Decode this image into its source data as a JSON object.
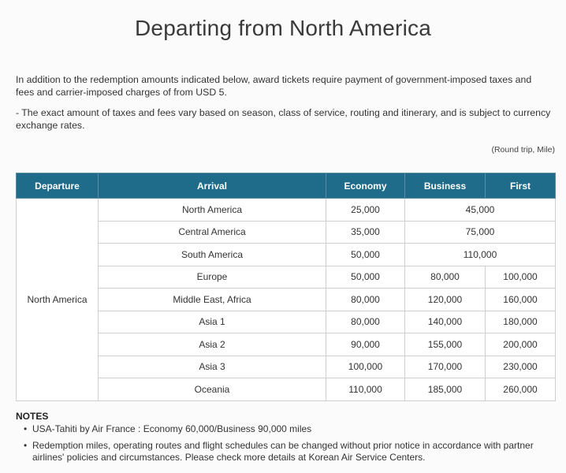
{
  "page": {
    "title": "Departing from North America",
    "intro": [
      "In addition to the redemption amounts indicated below, award tickets require payment of government-imposed taxes and fees and carrier-imposed charges of from USD 5.",
      "- The exact amount of taxes and fees vary based on season, class of service, routing and itinerary, and is subject to currency exchange rates."
    ],
    "unit_note": "(Round trip, Mile)"
  },
  "table": {
    "headers": {
      "departure": "Departure",
      "arrival": "Arrival",
      "economy": "Economy",
      "business": "Business",
      "first": "First"
    },
    "departure": "North America",
    "rows": [
      {
        "arrival": "North America",
        "economy": "25,000",
        "business_first": "45,000"
      },
      {
        "arrival": "Central America",
        "economy": "35,000",
        "business_first": "75,000"
      },
      {
        "arrival": "South America",
        "economy": "50,000",
        "business_first": "110,000"
      },
      {
        "arrival": "Europe",
        "economy": "50,000",
        "business": "80,000",
        "first": "100,000"
      },
      {
        "arrival": "Middle East, Africa",
        "economy": "80,000",
        "business": "120,000",
        "first": "160,000"
      },
      {
        "arrival": "Asia 1",
        "economy": "80,000",
        "business": "140,000",
        "first": "180,000"
      },
      {
        "arrival": "Asia 2",
        "economy": "90,000",
        "business": "155,000",
        "first": "200,000"
      },
      {
        "arrival": "Asia 3",
        "economy": "100,000",
        "business": "170,000",
        "first": "230,000"
      },
      {
        "arrival": "Oceania",
        "economy": "110,000",
        "business": "185,000",
        "first": "260,000"
      }
    ]
  },
  "notes": {
    "heading": "NOTES",
    "bullet": "•",
    "items": [
      "USA-Tahiti by Air France : Economy 60,000/Business 90,000 miles",
      "Redemption miles, operating routes and flight schedules can be changed without prior notice in accordance with partner airlines' policies and circumstances. Please check more details at Korean Air Service Centers."
    ]
  },
  "colors": {
    "header_bg": "#1e6b8a",
    "header_text": "#ffffff",
    "border": "#cfcfcf"
  }
}
